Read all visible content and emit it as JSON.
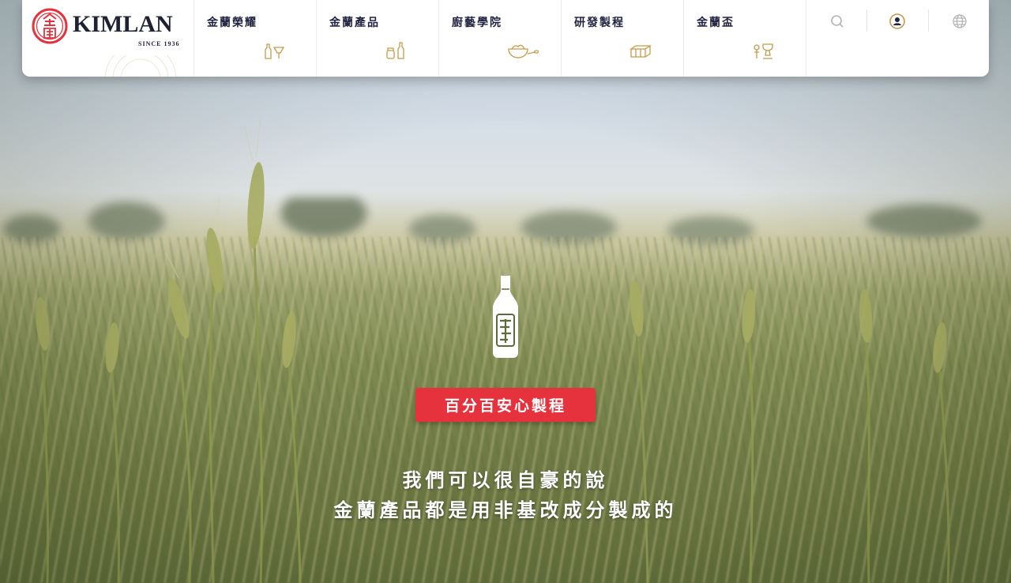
{
  "brand": {
    "name": "KIMLAN",
    "since": "SINCE 1936",
    "seal_text": "金蘭",
    "accent": "#e5323c",
    "navy": "#1f2240"
  },
  "nav": {
    "items": [
      {
        "label": "金蘭榮耀",
        "icon": "bottle-and-cup-icon"
      },
      {
        "label": "金蘭產品",
        "icon": "jar-and-bottle-icon"
      },
      {
        "label": "廚藝學院",
        "icon": "dish-and-spoon-icon"
      },
      {
        "label": "研發製程",
        "icon": "tofu-blocks-icon"
      },
      {
        "label": "金蘭盃",
        "icon": "trophy-chef-icon"
      }
    ],
    "utilities": [
      {
        "name": "search-icon"
      },
      {
        "name": "account-icon"
      },
      {
        "name": "globe-icon"
      }
    ]
  },
  "hero": {
    "badge": "百分百安心製程",
    "tagline_line1": "我們可以很自豪的說",
    "tagline_line2": "金蘭產品都是用非基改成分製成的"
  }
}
